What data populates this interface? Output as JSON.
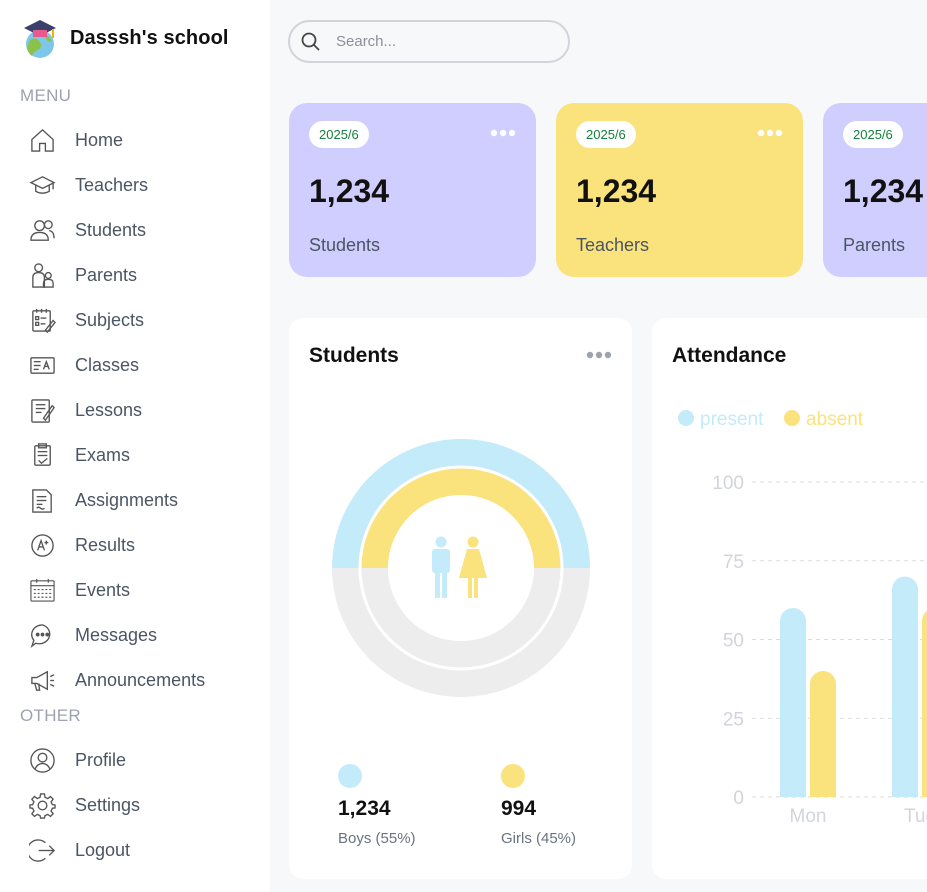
{
  "brand": {
    "name": "Dasssh's school"
  },
  "sidebar": {
    "menu_title": "MENU",
    "other_title": "OTHER",
    "menu_items": [
      {
        "label": "Home",
        "icon": "home-icon"
      },
      {
        "label": "Teachers",
        "icon": "graduation-cap-icon"
      },
      {
        "label": "Students",
        "icon": "users-icon"
      },
      {
        "label": "Parents",
        "icon": "parents-icon"
      },
      {
        "label": "Subjects",
        "icon": "subjects-icon"
      },
      {
        "label": "Classes",
        "icon": "classes-icon"
      },
      {
        "label": "Lessons",
        "icon": "lessons-icon"
      },
      {
        "label": "Exams",
        "icon": "exams-icon"
      },
      {
        "label": "Assignments",
        "icon": "assignments-icon"
      },
      {
        "label": "Results",
        "icon": "results-icon"
      },
      {
        "label": "Events",
        "icon": "calendar-icon"
      },
      {
        "label": "Messages",
        "icon": "message-icon"
      },
      {
        "label": "Announcements",
        "icon": "megaphone-icon"
      }
    ],
    "other_items": [
      {
        "label": "Profile",
        "icon": "profile-icon"
      },
      {
        "label": "Settings",
        "icon": "gear-icon"
      },
      {
        "label": "Logout",
        "icon": "logout-icon"
      }
    ]
  },
  "search": {
    "placeholder": "Search..."
  },
  "stat_cards": [
    {
      "date": "2025/6",
      "value": "1,234",
      "label": "Students",
      "color": "#CFCEFF"
    },
    {
      "date": "2025/6",
      "value": "1,234",
      "label": "Teachers",
      "color": "#FAE27C"
    },
    {
      "date": "2025/6",
      "value": "1,234",
      "label": "Parents",
      "color": "#CFCEFF"
    }
  ],
  "students_panel": {
    "title": "Students",
    "boys": {
      "value": "1,234",
      "label": "Boys (55%)",
      "color": "#C3EBFA"
    },
    "girls": {
      "value": "994",
      "label": "Girls (45%)",
      "color": "#FAE27C"
    }
  },
  "attendance_panel": {
    "title": "Attendance"
  },
  "chart_data": {
    "type": "bar",
    "title": "Attendance",
    "categories": [
      "Mon",
      "Tue"
    ],
    "series": [
      {
        "name": "present",
        "values": [
          60,
          70
        ],
        "color": "#C3EBFA"
      },
      {
        "name": "absent",
        "values": [
          40,
          60
        ],
        "color": "#FAE27C"
      }
    ],
    "y_ticks": [
      0,
      25,
      50,
      75,
      100
    ],
    "ylim": [
      0,
      100
    ],
    "grid": true,
    "legend": "top-left"
  }
}
